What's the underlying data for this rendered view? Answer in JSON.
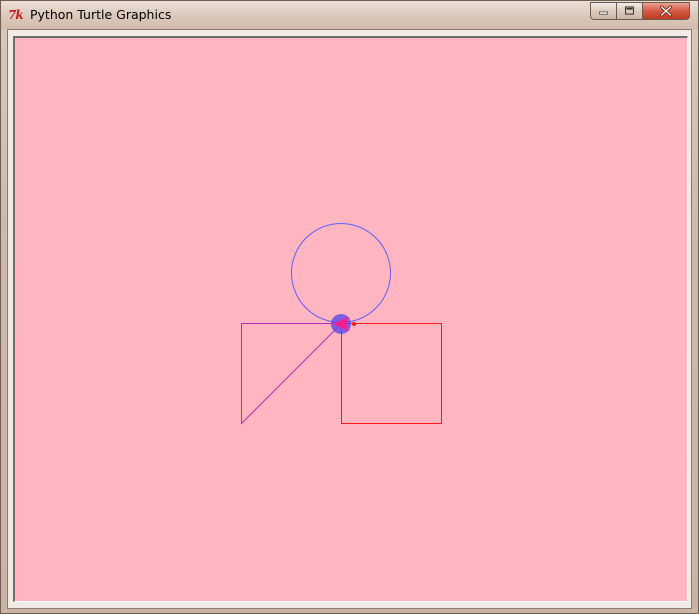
{
  "window": {
    "title": "Python Turtle Graphics",
    "app_icon_text": "7k"
  },
  "canvas": {
    "background_color": "#ffb6c1",
    "shapes": {
      "circle": {
        "color": "#6060ff"
      },
      "triangle": {
        "color": "#c02ab6"
      },
      "square": {
        "color": "#ff1a1a"
      }
    },
    "turtle": {
      "fill_color": "#ff1c8a",
      "outline_color": "#6a4ce8"
    }
  }
}
